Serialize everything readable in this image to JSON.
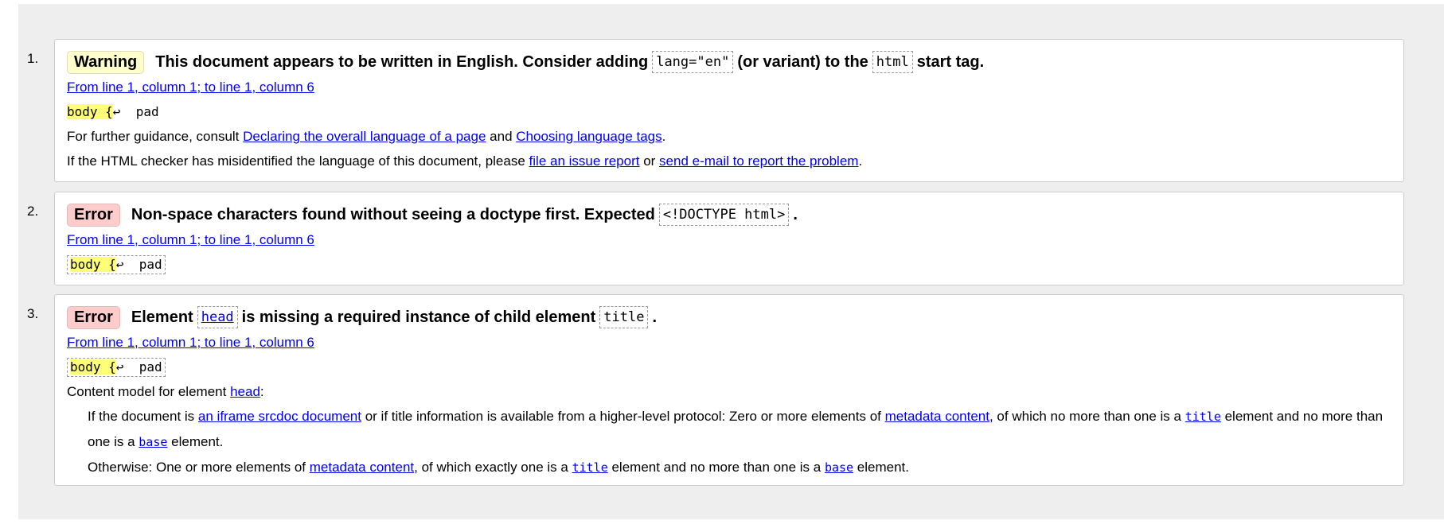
{
  "messages": [
    {
      "number": "1.",
      "type": "Warning",
      "text_before": "This document appears to be written in English. Consider adding",
      "code1": "lang=\"en\"",
      "text_mid": "(or variant) to the",
      "code2": "html",
      "text_after": "start tag.",
      "location": "From line 1, column 1; to line 1, column 6",
      "extract_hl": "body {",
      "extract_arrow": "↩",
      "extract_rest": "  pad",
      "guidance": {
        "prefix": "For further guidance, consult",
        "link1": "Declaring the overall language of a page",
        "and": "and",
        "link2": "Choosing language tags",
        "end": "."
      },
      "misid": {
        "prefix": "If the HTML checker has misidentified the language of this document, please",
        "link1": "file an issue report",
        "or": "or",
        "link2": "send e-mail to report the problem",
        "end": "."
      }
    },
    {
      "number": "2.",
      "type": "Error",
      "text_before": "Non-space characters found without seeing a doctype first. Expected",
      "code1": "<!DOCTYPE html>",
      "text_after": ".",
      "location": "From line 1, column 1; to line 1, column 6",
      "extract_hl": "body {",
      "extract_arrow": "↩",
      "extract_rest": "  pad"
    },
    {
      "number": "3.",
      "type": "Error",
      "text_before": "Element",
      "code1": "head",
      "text_mid": "is missing a required instance of child element",
      "code2": "title",
      "text_after": ".",
      "location": "From line 1, column 1; to line 1, column 6",
      "extract_hl": "body {",
      "extract_arrow": "↩",
      "extract_rest": "  pad",
      "content_model": {
        "prefix": "Content model for element",
        "link": "head",
        "end": ":",
        "p1": {
          "a": "If the document is",
          "l1": "an iframe srcdoc document",
          "b": "or if title information is available from a higher-level protocol: Zero or more elements of",
          "l2": "metadata content",
          "c": ", of which no more than one is a",
          "l3": "title",
          "d": "element and no more than one is a",
          "l4": "base",
          "e": "element."
        },
        "p2": {
          "a": "Otherwise: One or more elements of",
          "l1": "metadata content",
          "b": ", of which exactly one is a",
          "l2": "title",
          "c": "element and no more than one is a",
          "l3": "base",
          "d": "element."
        }
      }
    }
  ]
}
